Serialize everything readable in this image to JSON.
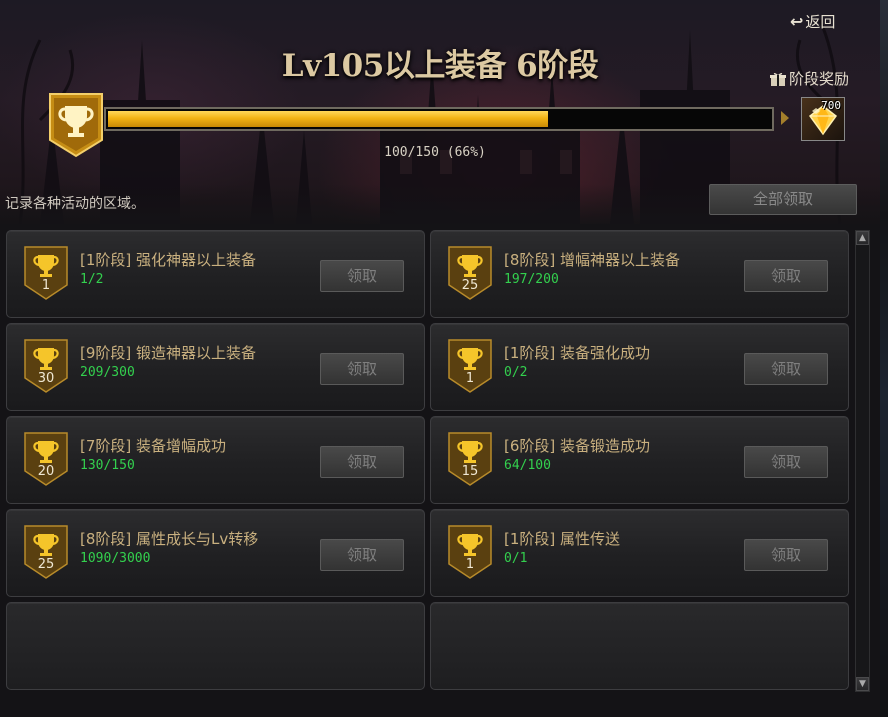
{
  "header": {
    "back_label": "返回",
    "title": "Lv105以上装备 6阶段",
    "stage_reward_label": "阶段奖励",
    "progress_text": "100/150 (66%)",
    "progress_fraction": 0.667,
    "reward_count": "700",
    "description": "记录各种活动的区域。",
    "claim_all_label": "全部领取"
  },
  "colors": {
    "accent_gold": "#f2b314",
    "title_color": "#dcc9a2",
    "progress_green": "#33d04e",
    "task_title": "#c9b07f"
  },
  "tasks": [
    {
      "title": "[1阶段] 强化神器以上装备",
      "progress": "1/2",
      "level": "1",
      "claim_label": "领取"
    },
    {
      "title": "[8阶段] 增幅神器以上装备",
      "progress": "197/200",
      "level": "25",
      "claim_label": "领取"
    },
    {
      "title": "[9阶段] 锻造神器以上装备",
      "progress": "209/300",
      "level": "30",
      "claim_label": "领取"
    },
    {
      "title": "[1阶段] 装备强化成功",
      "progress": "0/2",
      "level": "1",
      "claim_label": "领取"
    },
    {
      "title": "[7阶段] 装备增幅成功",
      "progress": "130/150",
      "level": "20",
      "claim_label": "领取"
    },
    {
      "title": "[6阶段] 装备锻造成功",
      "progress": "64/100",
      "level": "15",
      "claim_label": "领取"
    },
    {
      "title": "[8阶段] 属性成长与Lv转移",
      "progress": "1090/3000",
      "level": "25",
      "claim_label": "领取"
    },
    {
      "title": "[1阶段] 属性传送",
      "progress": "0/1",
      "level": "1",
      "claim_label": "领取"
    }
  ],
  "icons": {
    "back": "return-arrow-icon",
    "gift": "gift-icon",
    "trophy": "trophy-icon",
    "reward": "gem-icon",
    "scroll_up": "chevron-up-icon",
    "scroll_down": "chevron-down-icon"
  }
}
